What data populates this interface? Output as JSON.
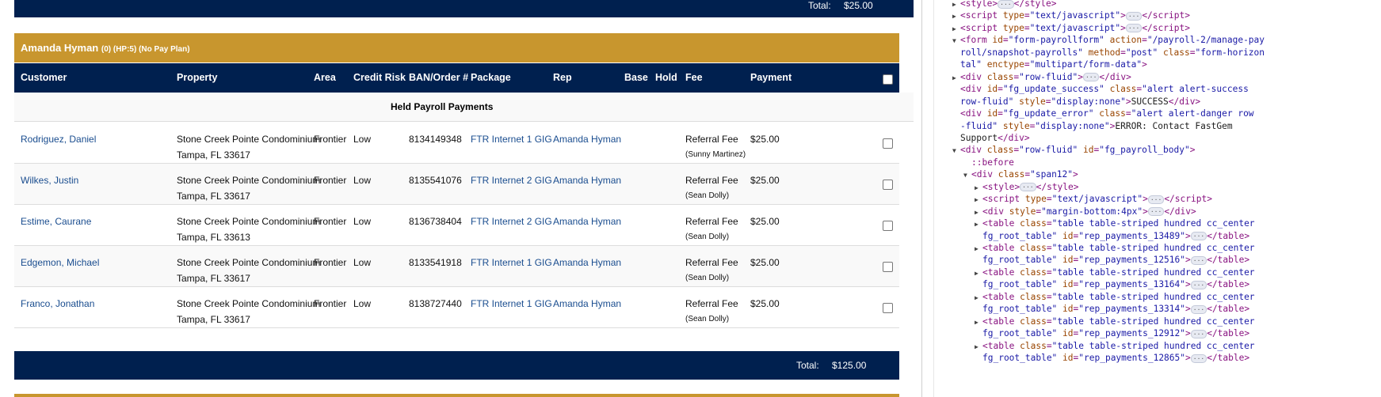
{
  "top_total": {
    "label": "Total:",
    "value": "$25.00"
  },
  "rep": {
    "name": "Amanda Hyman",
    "meta": "(0) (HP:5) (No Pay Plan)"
  },
  "columns": [
    "Customer",
    "Property",
    "Area",
    "Credit Risk",
    "BAN/Order #",
    "Package",
    "Rep",
    "Base",
    "Hold",
    "Fee",
    "Payment"
  ],
  "held_label": "Held Payroll Payments",
  "rows": [
    {
      "customer": "Rodriguez, Daniel",
      "property": "Stone Creek Pointe Condominium",
      "city": "Tampa, FL 33617",
      "area": "Frontier",
      "risk": "Low",
      "ban": "8134149348",
      "package": "FTR Internet 1 GIG",
      "rep": "Amanda Hyman",
      "fee": "Referral Fee",
      "fee_by": "(Sunny Martinez)",
      "payment": "$25.00"
    },
    {
      "customer": "Wilkes, Justin",
      "property": "Stone Creek Pointe Condominium",
      "city": "Tampa, FL 33617",
      "area": "Frontier",
      "risk": "Low",
      "ban": "8135541076",
      "package": "FTR Internet 2 GIG",
      "rep": "Amanda Hyman",
      "fee": "Referral Fee",
      "fee_by": "(Sean Dolly)",
      "payment": "$25.00"
    },
    {
      "customer": "Estime, Caurane",
      "property": "Stone Creek Pointe Condominium",
      "city": "Tampa, FL 33613",
      "area": "Frontier",
      "risk": "Low",
      "ban": "8136738404",
      "package": "FTR Internet 2 GIG",
      "rep": "Amanda Hyman",
      "fee": "Referral Fee",
      "fee_by": "(Sean Dolly)",
      "payment": "$25.00"
    },
    {
      "customer": "Edgemon, Michael",
      "property": "Stone Creek Pointe Condominium",
      "city": "Tampa, FL 33617",
      "area": "Frontier",
      "risk": "Low",
      "ban": "8133541918",
      "package": "FTR Internet 1 GIG",
      "rep": "Amanda Hyman",
      "fee": "Referral Fee",
      "fee_by": "(Sean Dolly)",
      "payment": "$25.00"
    },
    {
      "customer": "Franco, Jonathan",
      "property": "Stone Creek Pointe Condominium",
      "city": "Tampa, FL 33617",
      "area": "Frontier",
      "risk": "Low",
      "ban": "8138727440",
      "package": "FTR Internet 1 GIG",
      "rep": "Amanda Hyman",
      "fee": "Referral Fee",
      "fee_by": "(Sean Dolly)",
      "payment": "$25.00"
    }
  ],
  "bottom_total": {
    "label": "Total:",
    "value": "$125.00"
  },
  "devtools": {
    "colors": {
      "tag": "#881280",
      "attr": "#994500",
      "value": "#1a1aa6"
    },
    "lines": [
      {
        "indent": 0,
        "tri": "right",
        "html": "<span class='tag'>&lt;style&gt;</span><span class='ell'>···</span><span class='tag'>&lt;/style&gt;</span>"
      },
      {
        "indent": 0,
        "tri": "right",
        "html": "<span class='tag'>&lt;script </span><span class='attr'>type</span><span class='tag'>=</span><span class='val2'>\"text/javascript\"</span><span class='tag'>&gt;</span><span class='ell'>···</span><span class='tag'>&lt;/script&gt;</span>"
      },
      {
        "indent": 0,
        "tri": "right",
        "html": "<span class='tag'>&lt;script </span><span class='attr'>type</span><span class='tag'>=</span><span class='val2'>\"text/javascript\"</span><span class='tag'>&gt;</span><span class='ell'>···</span><span class='tag'>&lt;/script&gt;</span>"
      },
      {
        "indent": 0,
        "tri": "down",
        "html": "<span class='tag'>&lt;form </span><span class='attr'>id</span><span class='tag'>=</span><span class='val2'>\"form-payrollform\"</span> <span class='attr'>action</span><span class='tag'>=</span><span class='val2'>\"/payroll-2/manage-pay</span>"
      },
      {
        "indent": 0,
        "tri": "",
        "html": "<span class='val2'>roll/snapshot-payrolls\"</span> <span class='attr'>method</span><span class='tag'>=</span><span class='val2'>\"post\"</span> <span class='attr'>class</span><span class='tag'>=</span><span class='val2'>\"form-horizon</span>"
      },
      {
        "indent": 0,
        "tri": "",
        "html": "<span class='val2'>tal\"</span> <span class='attr'>enctype</span><span class='tag'>=</span><span class='val2'>\"multipart/form-data\"</span><span class='tag'>&gt;</span>"
      },
      {
        "indent": 1,
        "tri": "right",
        "html": "<span class='tag'>&lt;div </span><span class='attr'>class</span><span class='tag'>=</span><span class='val2'>\"row-fluid\"</span><span class='tag'>&gt;</span><span class='ell'>···</span><span class='tag'>&lt;/div&gt;</span>"
      },
      {
        "indent": 1,
        "tri": "",
        "html": "<span class='tag'>&lt;div </span><span class='attr'>id</span><span class='tag'>=</span><span class='val2'>\"fg_update_success\"</span> <span class='attr'>class</span><span class='tag'>=</span><span class='val2'>\"alert alert-success</span>"
      },
      {
        "indent": 1,
        "tri": "",
        "html": "<span class='val2'>row-fluid\"</span> <span class='attr'>style</span><span class='tag'>=</span><span class='val2'>\"display:none\"</span><span class='tag'>&gt;</span><span class='txt'>SUCCESS</span><span class='tag'>&lt;/div&gt;</span>"
      },
      {
        "indent": 1,
        "tri": "",
        "html": "<span class='tag'>&lt;div </span><span class='attr'>id</span><span class='tag'>=</span><span class='val2'>\"fg_update_error\"</span> <span class='attr'>class</span><span class='tag'>=</span><span class='val2'>\"alert alert-danger row</span>"
      },
      {
        "indent": 1,
        "tri": "",
        "html": "<span class='val2'>-fluid\"</span> <span class='attr'>style</span><span class='tag'>=</span><span class='val2'>\"display:none\"</span><span class='tag'>&gt;</span><span class='txt'>ERROR: Contact FastGem</span>"
      },
      {
        "indent": 1,
        "tri": "",
        "html": "<span class='txt'>Support</span><span class='tag'>&lt;/div&gt;</span>"
      },
      {
        "indent": 1,
        "tri": "down",
        "html": "<span class='tag'>&lt;div </span><span class='attr'>class</span><span class='tag'>=</span><span class='val2'>\"row-fluid\"</span> <span class='attr'>id</span><span class='tag'>=</span><span class='val2'>\"fg_payroll_body\"</span><span class='tag'>&gt;</span>"
      },
      {
        "indent": 2,
        "tri": "",
        "html": "<span class='pseudo'>::before</span>"
      },
      {
        "indent": 2,
        "tri": "down",
        "html": "<span class='tag'>&lt;div </span><span class='attr'>class</span><span class='tag'>=</span><span class='val2'>\"span12\"</span><span class='tag'>&gt;</span>"
      },
      {
        "indent": 3,
        "tri": "right",
        "html": "<span class='tag'>&lt;style&gt;</span><span class='ell'>···</span><span class='tag'>&lt;/style&gt;</span>"
      },
      {
        "indent": 3,
        "tri": "right",
        "html": "<span class='tag'>&lt;script </span><span class='attr'>type</span><span class='tag'>=</span><span class='val2'>\"text/javascript\"</span><span class='tag'>&gt;</span><span class='ell'>···</span><span class='tag'>&lt;/script&gt;</span>"
      },
      {
        "indent": 3,
        "tri": "right",
        "html": "<span class='tag'>&lt;div </span><span class='attr'>style</span><span class='tag'>=</span><span class='val2'>\"margin-bottom:4px\"</span><span class='tag'>&gt;</span><span class='ell'>···</span><span class='tag'>&lt;/div&gt;</span>"
      },
      {
        "indent": 3,
        "tri": "right",
        "html": "<span class='tag'>&lt;table </span><span class='attr'>class</span><span class='tag'>=</span><span class='val2'>\"table table-striped hundred cc_center</span>"
      },
      {
        "indent": 3,
        "tri": "",
        "html": "<span class='val2'>fg_root_table\"</span> <span class='attr'>id</span><span class='tag'>=</span><span class='val2'>\"rep_payments_13489\"</span><span class='tag'>&gt;</span><span class='ell'>···</span><span class='tag'>&lt;/table&gt;</span>"
      },
      {
        "indent": 3,
        "tri": "right",
        "html": "<span class='tag'>&lt;table </span><span class='attr'>class</span><span class='tag'>=</span><span class='val2'>\"table table-striped hundred cc_center</span>"
      },
      {
        "indent": 3,
        "tri": "",
        "html": "<span class='val2'>fg_root_table\"</span> <span class='attr'>id</span><span class='tag'>=</span><span class='val2'>\"rep_payments_12516\"</span><span class='tag'>&gt;</span><span class='ell'>···</span><span class='tag'>&lt;/table&gt;</span>"
      },
      {
        "indent": 3,
        "tri": "right",
        "html": "<span class='tag'>&lt;table </span><span class='attr'>class</span><span class='tag'>=</span><span class='val2'>\"table table-striped hundred cc_center</span>"
      },
      {
        "indent": 3,
        "tri": "",
        "html": "<span class='val2'>fg_root_table\"</span> <span class='attr'>id</span><span class='tag'>=</span><span class='val2'>\"rep_payments_13164\"</span><span class='tag'>&gt;</span><span class='ell'>···</span><span class='tag'>&lt;/table&gt;</span>"
      },
      {
        "indent": 3,
        "tri": "right",
        "html": "<span class='tag'>&lt;table </span><span class='attr'>class</span><span class='tag'>=</span><span class='val2'>\"table table-striped hundred cc_center</span>"
      },
      {
        "indent": 3,
        "tri": "",
        "html": "<span class='val2'>fg_root_table\"</span> <span class='attr'>id</span><span class='tag'>=</span><span class='val2'>\"rep_payments_13314\"</span><span class='tag'>&gt;</span><span class='ell'>···</span><span class='tag'>&lt;/table&gt;</span>"
      },
      {
        "indent": 3,
        "tri": "right",
        "html": "<span class='tag'>&lt;table </span><span class='attr'>class</span><span class='tag'>=</span><span class='val2'>\"table table-striped hundred cc_center</span>"
      },
      {
        "indent": 3,
        "tri": "",
        "html": "<span class='val2'>fg_root_table\"</span> <span class='attr'>id</span><span class='tag'>=</span><span class='val2'>\"rep_payments_12912\"</span><span class='tag'>&gt;</span><span class='ell'>···</span><span class='tag'>&lt;/table&gt;</span>"
      },
      {
        "indent": 3,
        "tri": "right",
        "html": "<span class='tag'>&lt;table </span><span class='attr'>class</span><span class='tag'>=</span><span class='val2'>\"table table-striped hundred cc_center</span>"
      },
      {
        "indent": 3,
        "tri": "",
        "html": "<span class='val2'>fg_root_table\"</span> <span class='attr'>id</span><span class='tag'>=</span><span class='val2'>\"rep_payments_12865\"</span><span class='tag'>&gt;</span><span class='ell'>···</span><span class='tag'>&lt;/table&gt;</span>"
      }
    ]
  }
}
